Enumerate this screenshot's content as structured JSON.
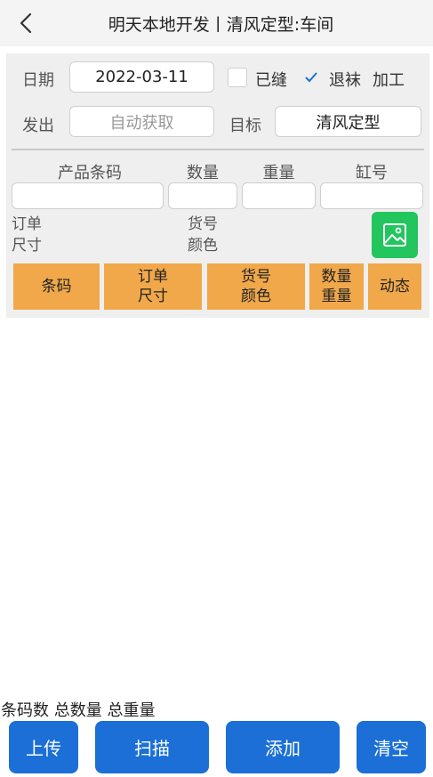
{
  "header": {
    "title": "明天本地开发丨清风定型:车间"
  },
  "form": {
    "date_label": "日期",
    "date_value": "2022-03-11",
    "sewn_label": "已缝",
    "sewn_checked": false,
    "return_label": "退袜",
    "return_checked": true,
    "process_label": "加工",
    "send_label": "发出",
    "send_placeholder": "自动获取",
    "target_label": "目标",
    "target_value": "清风定型"
  },
  "entry": {
    "barcode_label": "产品条码",
    "quantity_label": "数量",
    "weight_label": "重量",
    "vat_label": "缸号"
  },
  "info": {
    "order_label": "订单",
    "size_label": "尺寸",
    "item_label": "货号",
    "color_label": "颜色"
  },
  "tabs": [
    {
      "line1": "条码",
      "line2": ""
    },
    {
      "line1": "订单",
      "line2": "尺寸"
    },
    {
      "line1": "货号",
      "line2": "颜色"
    },
    {
      "line1": "数量",
      "line2": "重量"
    },
    {
      "line1": "动态",
      "line2": ""
    }
  ],
  "summary": {
    "text": "条码数 总数量 总重量"
  },
  "actions": {
    "upload": "上传",
    "scan": "扫描",
    "add": "添加",
    "clear": "清空"
  },
  "colors": {
    "accent": "#1b6fd6",
    "tab": "#f0a84a",
    "image_button": "#22c55e"
  }
}
